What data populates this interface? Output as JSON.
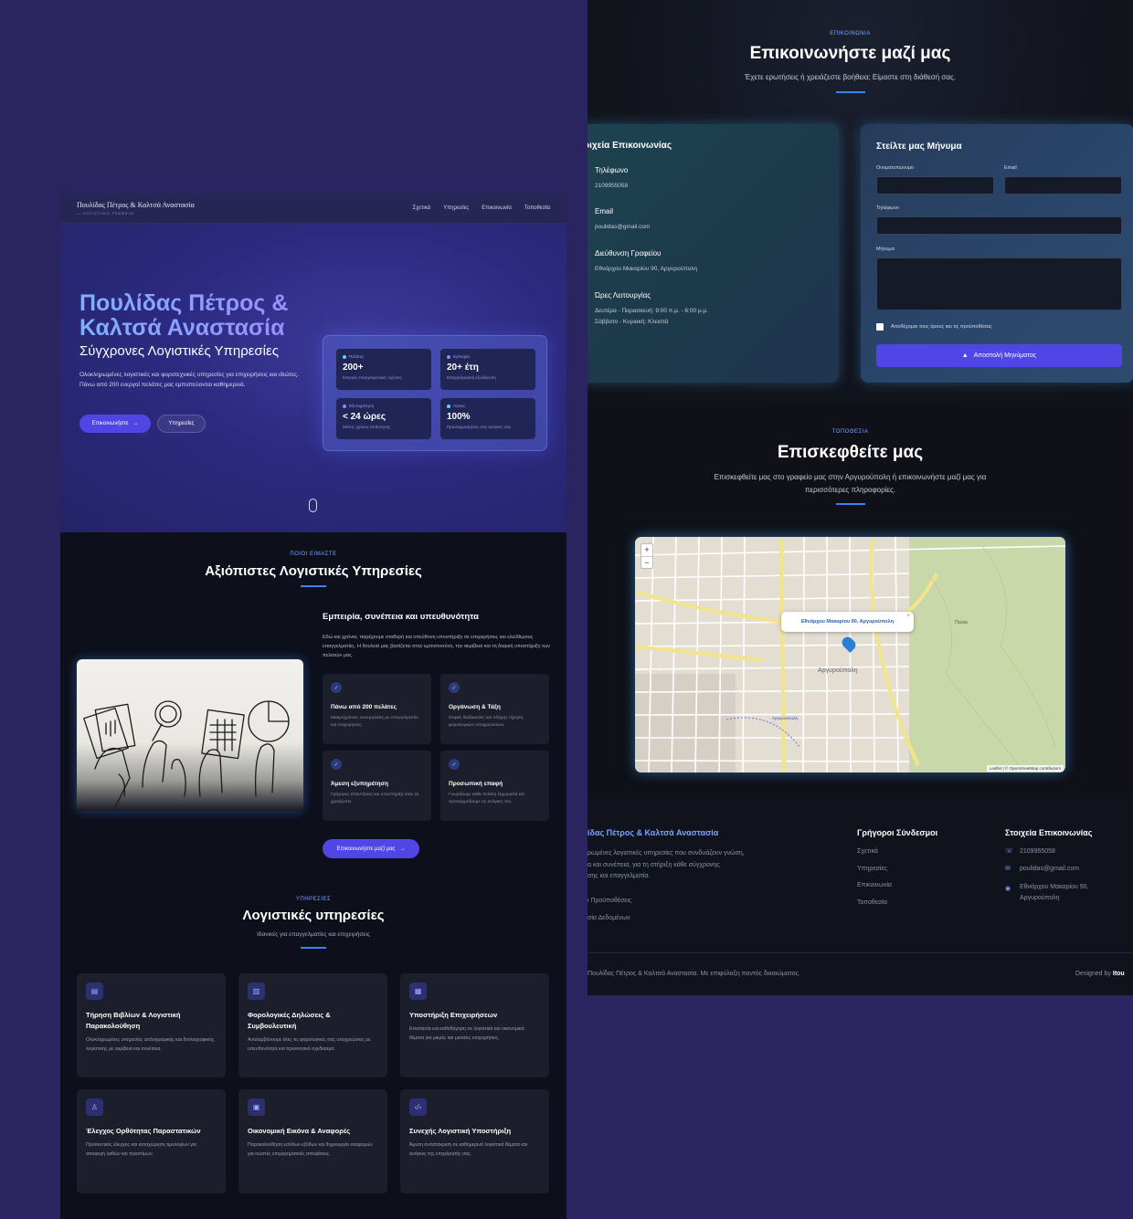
{
  "left": {
    "nav": {
      "brand": "Πουλίδας Πέτρος & Καλτσά Αναστασία",
      "brand_sub": "— ΛΟΓΙΣΤΙΚΟ ΓΡΑΦΕΙΟ",
      "links": [
        "Σχετικά",
        "Υπηρεσίες",
        "Επικοινωνία",
        "Τοποθεσία"
      ]
    },
    "hero": {
      "title_line1": "Πουλίδας Πέτρος &",
      "title_line2": "Καλτσά Αναστασία",
      "subtitle": "Σύγχρονες Λογιστικές Υπηρεσίες",
      "description": "Ολοκληρωμένες λογιστικές και φοροτεχνικές υπηρεσίες για επιχειρήσεις και ιδιώτες. Πάνω από 200 ενεργοί πελάτες μας εμπιστεύονται καθημερινά.",
      "primary_btn": "Επικοινωνήστε",
      "secondary_btn": "Υπηρεσίες",
      "stats": [
        {
          "label": "Πελάτες",
          "value": "200+",
          "note": "Ενεργές επαγγελματικές σχέσεις"
        },
        {
          "label": "Εμπειρία",
          "value": "20+ έτη",
          "note": "Επαγγελματική εξειδίκευση"
        },
        {
          "label": "Εξυπηρέτηση",
          "value": "< 24 ώρες",
          "note": "Μέσος χρόνος απάντησης"
        },
        {
          "label": "Λύσεις",
          "value": "100%",
          "note": "Προσαρμοσμένες στις ανάγκες σας"
        }
      ]
    },
    "about": {
      "tag": "ΠΟΙΟΙ ΕΙΜΑΣΤΕ",
      "title": "Αξιόπιστες Λογιστικές Υπηρεσίες",
      "heading": "Εμπειρία, συνέπεια και υπευθυνότητα",
      "text": "Εδώ και χρόνια, παρέχουμε σταθερή και υπεύθυνη υποστήριξη σε επιχειρήσεις και ελεύθερους επαγγελματίες. Η δουλειά μας βασίζεται στην εμπιστοσύνη, την ακρίβεια και τη διαρκή υποστήριξη των πελατών μας.",
      "features": [
        {
          "title": "Πάνω από 200 πελάτες",
          "desc": "Μακροχρόνιες συνεργασίες με επαγγελματίες και επιχειρήσεις."
        },
        {
          "title": "Οργάνωση & Τάξη",
          "desc": "Σαφείς διαδικασίες και πλήρης τήρηση φορολογικών υποχρεώσεων."
        },
        {
          "title": "Άμεση εξυπηρέτηση",
          "desc": "Γρήγορες απαντήσεις και υποστήριξη όταν τη χρειάζεστε."
        },
        {
          "title": "Προσωπική επαφή",
          "desc": "Γνωρίζουμε κάθε πελάτη ξεχωριστά και προσαρμόζουμε τις ανάγκες του."
        }
      ],
      "cta": "Επικοινωνήστε μαζί μας"
    },
    "services": {
      "tag": "ΥΠΗΡΕΣΙΕΣ",
      "title": "Λογιστικές υπηρεσίες",
      "subtitle": "Ιδανικές για επαγγελματίες και επιχειρήσεις",
      "items": [
        {
          "title": "Τήρηση Βιβλίων & Λογιστική Παρακολούθηση",
          "desc": "Ολοκληρωμένες υπηρεσίες απλογραφικής και διπλογραφικής λογιστικής με ακρίβεια και συνέπεια."
        },
        {
          "title": "Φορολογικές Δηλώσεις & Συμβουλευτική",
          "desc": "Αναλαμβάνουμε όλες τις φορολογικές σας υποχρεώσεις με υπευθυνότητα και προνοητικό σχεδιασμό."
        },
        {
          "title": "Υποστήριξη Επιχειρήσεων",
          "desc": "Επιστασία και καθοδήγηση σε λογιστικά και οικονομικά θέματα για μικρές και μεσαίες επιχειρήσεις."
        },
        {
          "title": "Έλεγχος Ορθότητας Παραστατικών",
          "desc": "Προσεκτικός έλεγχος και καταχώρηση τιμολογίων για αποφυγή λαθών και προστίμων."
        },
        {
          "title": "Οικονομική Εικόνα & Αναφορές",
          "desc": "Παρακολούθηση εσόδων-εξόδων και δημιουργία αναφορών για σωστές επιχειρηματικές αποφάσεις."
        },
        {
          "title": "Συνεχής Λογιστική Υποστήριξη",
          "desc": "Άμεση ανταπόκριση σε καθημερινά λογιστικά θέματα και ανάγκες της επιχείρησής σας."
        }
      ]
    }
  },
  "right": {
    "contact": {
      "tag": "ΕΠΙΚΟΙΝΩΝΙΑ",
      "title": "Επικοινωνήστε μαζί μας",
      "subtitle": "Έχετε ερωτήσεις ή χρειάζεστε βοήθεια; Είμαστε στη διάθεσή σας.",
      "info_title": "οιχεία Επικοινωνίας",
      "items": [
        {
          "key": "Τηλέφωνο",
          "value": "2109955058"
        },
        {
          "key": "Email",
          "value": "poulidas@gmail.com"
        },
        {
          "key": "Διεύθυνση Γραφείου",
          "value": "Εθνάρχου Μακαρίου 90, Αργυρούπολη"
        },
        {
          "key": "Ώρες Λειτουργίας",
          "value": "Δευτέρα - Παρασκευή: 9:00 π.μ. - 6:00 μ.μ.",
          "value2": "Σάββατο - Κυριακή: Κλειστά"
        }
      ],
      "form": {
        "title": "Στείλτε μας Μήνυμα",
        "name_label": "Ονοματεπώνυμο",
        "email_label": "Email",
        "phone_label": "Τηλέφωνο",
        "message_label": "Μήνυμα",
        "terms": "Αποδέχομαι τους όρους και τις προϋποθέσεις",
        "submit": "Αποστολή Μηνύματος"
      }
    },
    "location": {
      "tag": "ΤΟΠΟΘΕΣΙΑ",
      "title": "Επισκεφθείτε μας",
      "subtitle_line1": "Επισκεφθείτε μας στο γραφείο μας στην Αργυρούπολη ή επικοινωνήστε μαζί μας για",
      "subtitle_line2": "περισσότερες πληροφορίες.",
      "popup": "Εθνάρχου Μακαρίου 90, Αργυρούπολη",
      "zoom_in": "+",
      "zoom_out": "−",
      "attribution": "Leaflet | © OpenStreetMap contributors",
      "map_labels": [
        "Αργυρούπολη",
        "Πεύκα",
        "Αργυρούπολη"
      ]
    },
    "footer": {
      "brand": "ίδας Πέτρος & Καλτσά Αναστασία",
      "desc_line1": "ρωμένες λογιστικές υπηρεσίες που συνδυάζουν γνώση,",
      "desc_line2": "α και συνέπεια, για τη στήριξη κάθε σύγχρονης",
      "desc_line3": "σης και επαγγελματία.",
      "legal1": "ι Προϋποθέσεις",
      "legal2": "σία Δεδομένων",
      "quick_title": "Γρήγοροι Σύνδεσμοι",
      "quick_links": [
        "Σχετικά",
        "Υπηρεσίες",
        "Επικοινωνία",
        "Τοποθεσία"
      ],
      "contact_title": "Στοιχεία Επικοινωνίας",
      "phone": "2109955058",
      "email": "poulidas@gmail.com",
      "address_line1": "Εθνάρχου Μακαρίου 90,",
      "address_line2": "Αργυρούπολη",
      "copyright": "Πουλίδας Πέτρος & Καλτσά Αναστασία. Με επιφύλαξη παντός δικαιώματος.",
      "designed_by": "Designed by",
      "designer": "Itou"
    }
  },
  "colors": {
    "accent": "#4f46e5",
    "tag": "#7aa4ff",
    "bg_outer": "#2a2560"
  }
}
